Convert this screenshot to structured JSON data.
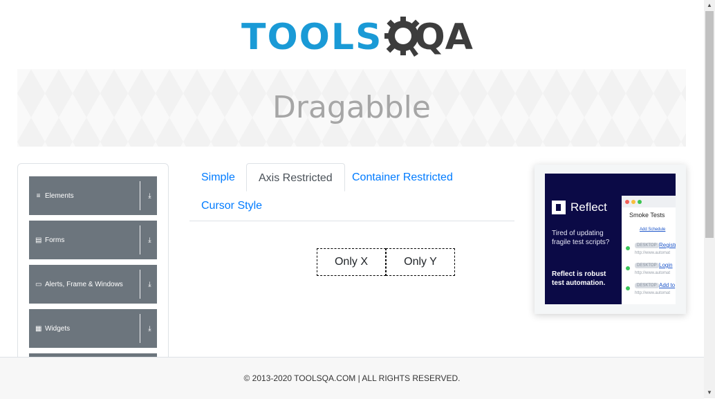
{
  "logo": {
    "part1": "TOOLS",
    "part2": "QA"
  },
  "banner": {
    "title": "Dragabble"
  },
  "sidebar": {
    "groups": [
      {
        "label": "Elements",
        "icon": "≡",
        "arrow": "⤓"
      },
      {
        "label": "Forms",
        "icon": "▤",
        "arrow": "⤓"
      },
      {
        "label": "Alerts, Frame & Windows",
        "icon": "▭",
        "arrow": "⤓"
      },
      {
        "label": "Widgets",
        "icon": "▦",
        "arrow": "⤓"
      }
    ]
  },
  "tabs": [
    {
      "label": "Simple"
    },
    {
      "label": "Axis Restricted"
    },
    {
      "label": "Container Restricted"
    },
    {
      "label": "Cursor Style"
    }
  ],
  "active_tab": "Axis Restricted",
  "drag_boxes": {
    "x_label": "Only X",
    "y_label": "Only Y"
  },
  "ad": {
    "brand": "Reflect",
    "tagline": "Tired of updating fragile test scripts?",
    "pitch": "Reflect is robust test automation.",
    "window_title": "Smoke Tests",
    "add_schedule": "Add Schedule",
    "rows": [
      {
        "tag": "DESKTOP",
        "link": "Registr",
        "url": "http://www.automat"
      },
      {
        "tag": "DESKTOP",
        "link": "Login",
        "url": "http://www.automat"
      },
      {
        "tag": "DESKTOP",
        "link": "Add to",
        "url": "http://www.automat"
      }
    ],
    "colors": {
      "bg": "#0b0a46"
    }
  },
  "footer": {
    "text": "© 2013-2020 TOOLSQA.COM | ALL RIGHTS RESERVED."
  },
  "colors": {
    "accent": "#007bff",
    "sidebar_group": "#6c757d",
    "logo_blue": "#1a9ad6",
    "logo_dark": "#3d3d3d"
  }
}
